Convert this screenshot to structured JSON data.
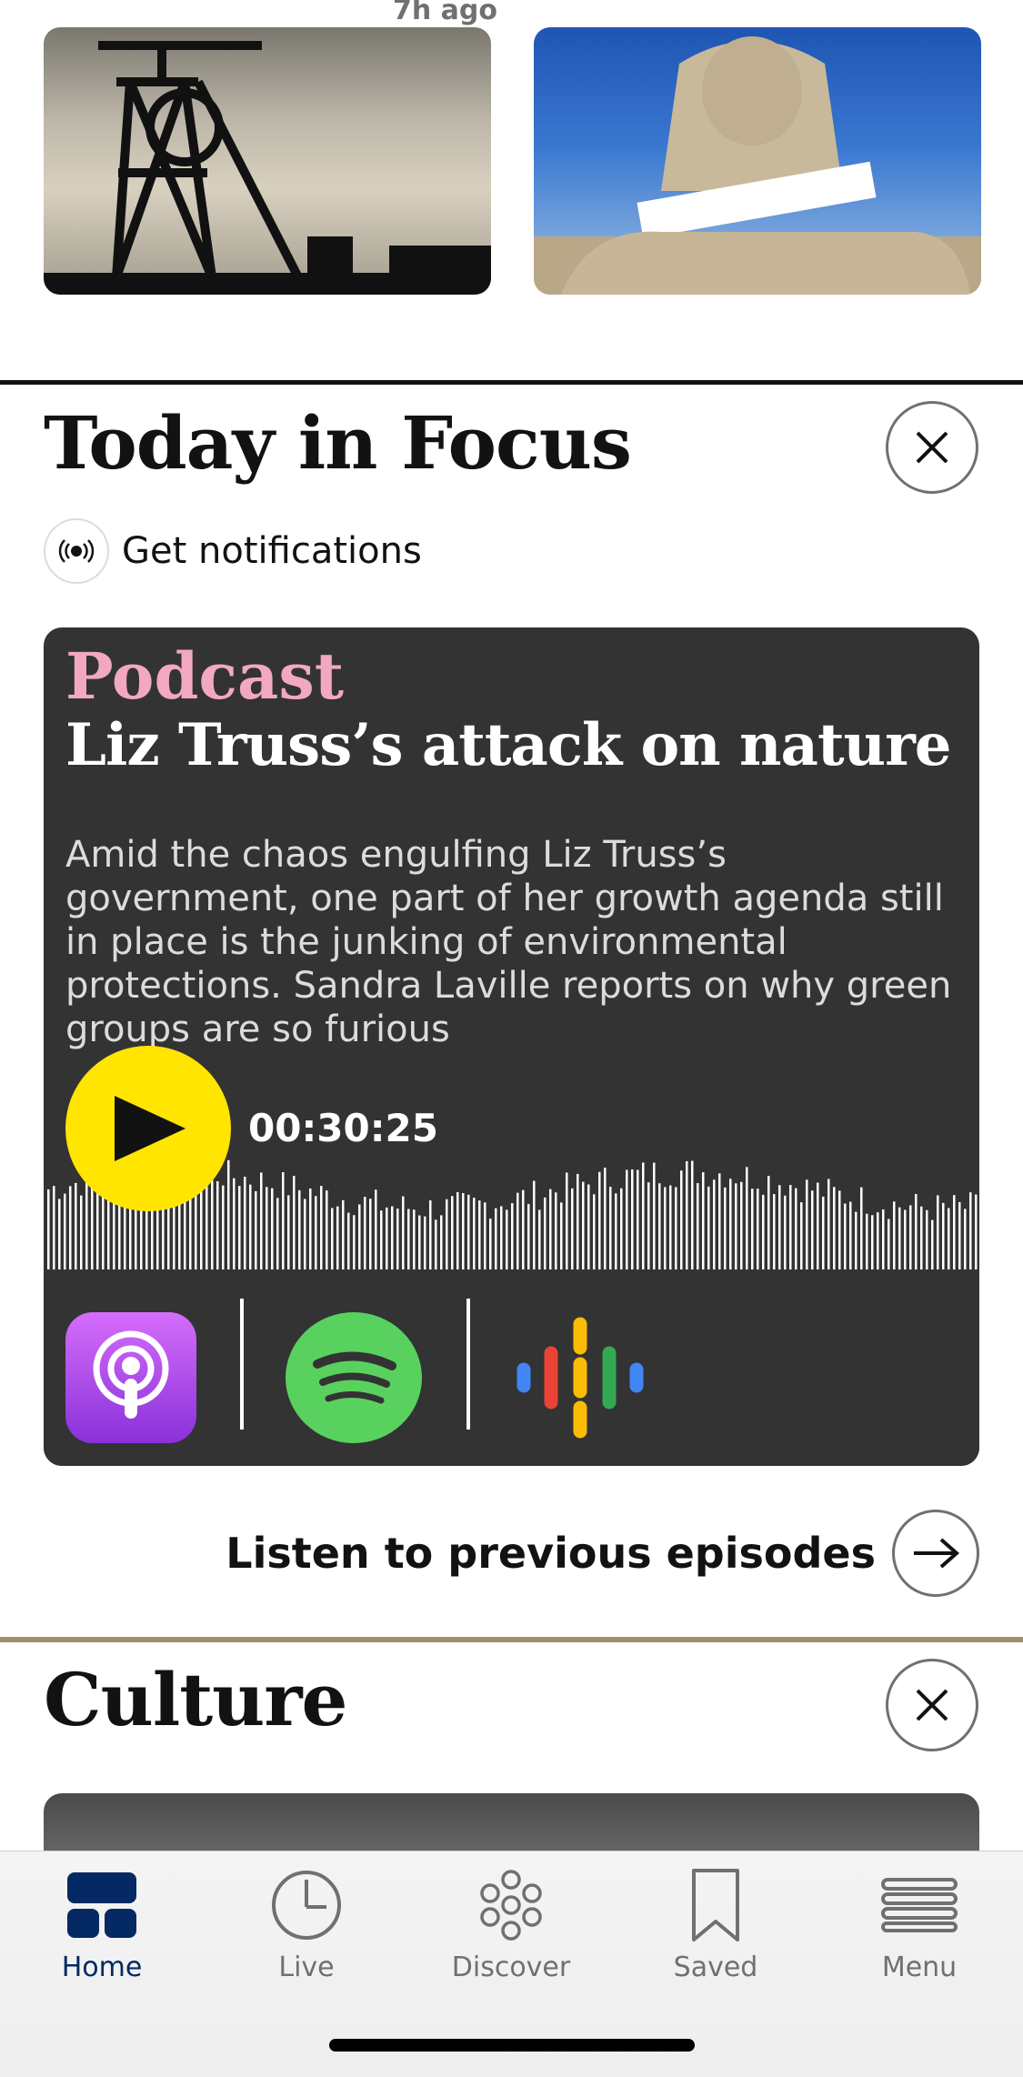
{
  "top_stories": {
    "timestamp": "7h ago"
  },
  "focus_section": {
    "title": "Today in Focus",
    "notifications_label": "Get notifications",
    "podcast": {
      "kicker": "Podcast",
      "headline": "Liz Truss’s attack on nature",
      "description": "Amid the chaos engulfing Liz Truss’s government, one part of her growth agenda still in place is the junking of environmental protections. Sandra Laville reports on why green groups are so furious",
      "duration": "00:30:25",
      "providers": [
        "apple-podcasts-icon",
        "spotify-icon",
        "google-podcasts-icon"
      ]
    },
    "previous_link": "Listen to previous episodes"
  },
  "culture_section": {
    "title": "Culture"
  },
  "tabbar": {
    "items": [
      {
        "label": "Home",
        "icon": "home-icon",
        "active": true
      },
      {
        "label": "Live",
        "icon": "clock-icon",
        "active": false
      },
      {
        "label": "Discover",
        "icon": "discover-icon",
        "active": false
      },
      {
        "label": "Saved",
        "icon": "bookmark-icon",
        "active": false
      },
      {
        "label": "Menu",
        "icon": "menu-icon",
        "active": false
      }
    ]
  },
  "colors": {
    "brand_blue": "#052962",
    "podcast_pink": "#f2a9c0",
    "play_yellow": "#ffe500",
    "culture_gold": "#a1906c"
  }
}
